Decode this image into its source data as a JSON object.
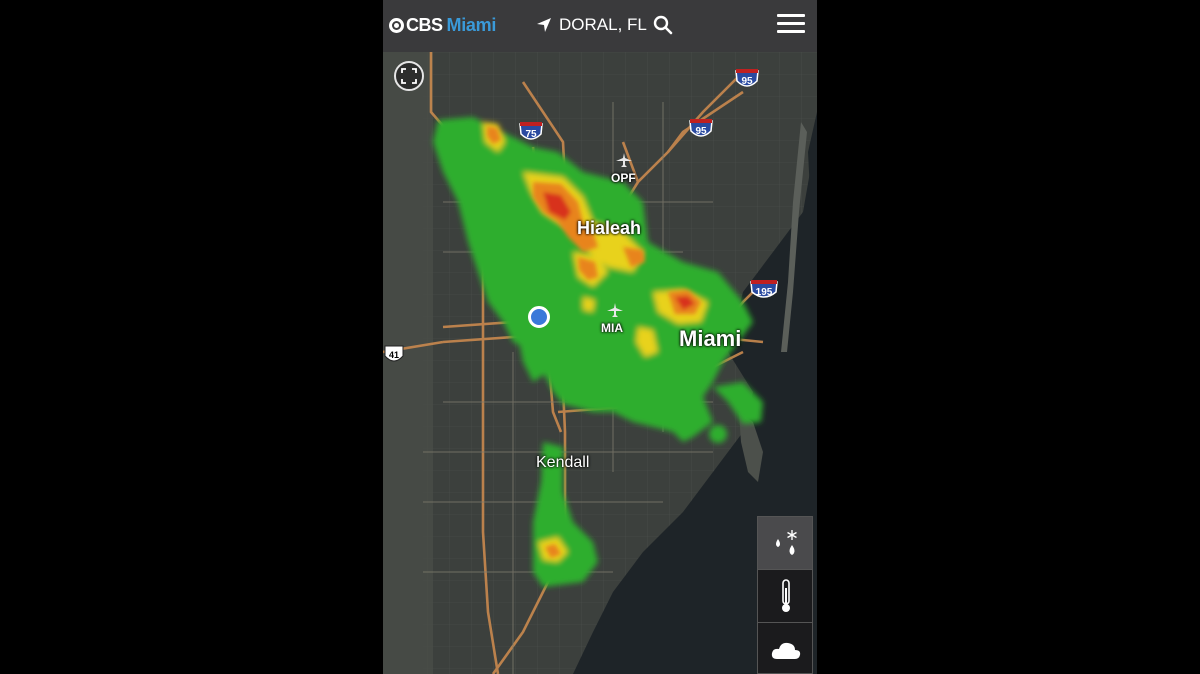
{
  "header": {
    "brand_network": "CBS",
    "brand_city": "Miami",
    "location": "DORAL, FL"
  },
  "map": {
    "labels": {
      "hialeah": "Hialeah",
      "miami": "Miami",
      "kendall": "Kendall",
      "opf": "OPF",
      "mia": "MIA"
    },
    "shields": {
      "i75": "75",
      "i95_north": "95",
      "i95_mid": "95",
      "i195": "195",
      "us41": "41"
    },
    "layer": "radar"
  },
  "toolbar": {
    "items": [
      "precipitation-icon",
      "temperature-icon",
      "cloud-icon"
    ],
    "active": "precipitation-icon"
  },
  "colors": {
    "header_bg": "#3a3a3c",
    "brand_accent": "#3a9ad9",
    "radar_green": "#2fae2f",
    "radar_yellow": "#e8d21a",
    "radar_orange": "#e8841a",
    "radar_red": "#d8301a",
    "water": "#1e2428"
  }
}
